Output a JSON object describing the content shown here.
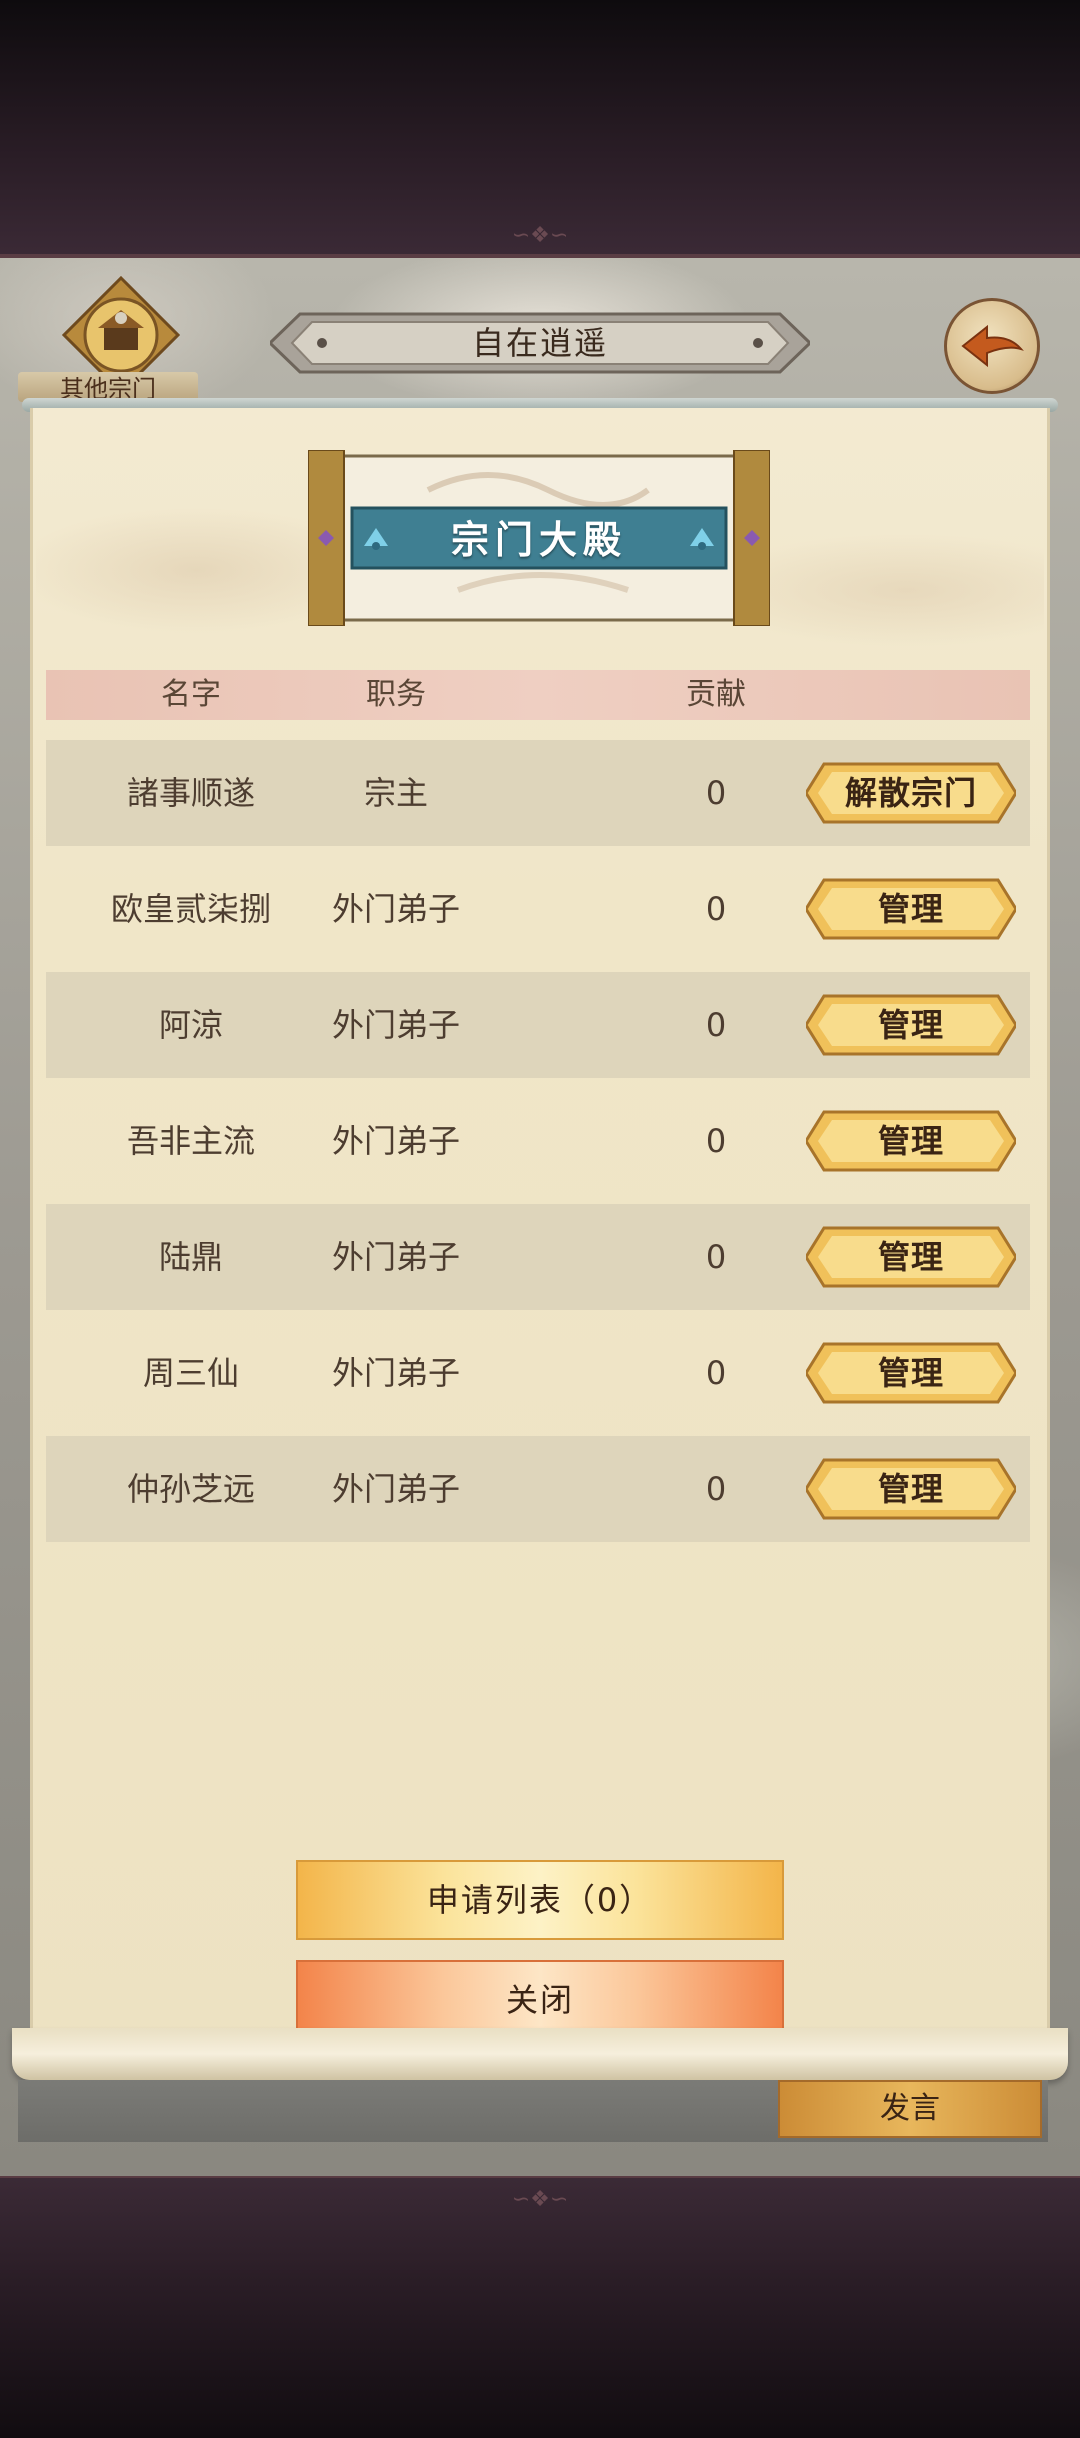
{
  "header": {
    "other_sect_label": "其他宗门",
    "sect_name": "自在逍遥"
  },
  "banner": {
    "title": "宗门大殿"
  },
  "table": {
    "columns": [
      "名字",
      "职务",
      "贡献"
    ],
    "rows": [
      {
        "name": "諸事顺遂",
        "role": "宗主",
        "contribution": "0",
        "action": "解散宗门"
      },
      {
        "name": "欧皇贰柒捌",
        "role": "外门弟子",
        "contribution": "0",
        "action": "管理"
      },
      {
        "name": "阿涼",
        "role": "外门弟子",
        "contribution": "0",
        "action": "管理"
      },
      {
        "name": "吾非主流",
        "role": "外门弟子",
        "contribution": "0",
        "action": "管理"
      },
      {
        "name": "陆鼎",
        "role": "外门弟子",
        "contribution": "0",
        "action": "管理"
      },
      {
        "name": "周三仙",
        "role": "外门弟子",
        "contribution": "0",
        "action": "管理"
      },
      {
        "name": "仲孙芝远",
        "role": "外门弟子",
        "contribution": "0",
        "action": "管理"
      }
    ]
  },
  "footer": {
    "apply_list_label": "申请列表（0）",
    "close_label": "关闭",
    "speak_label": "发言"
  },
  "icons": {
    "back": "back-arrow-icon",
    "emblem": "sect-emblem-icon",
    "fan": "fan-icon"
  },
  "colors": {
    "gold_button": "#f0c15a",
    "panel_bg": "#f0e6c8",
    "header_row": "#efcfc2",
    "banner_teal": "#3f7f92"
  }
}
